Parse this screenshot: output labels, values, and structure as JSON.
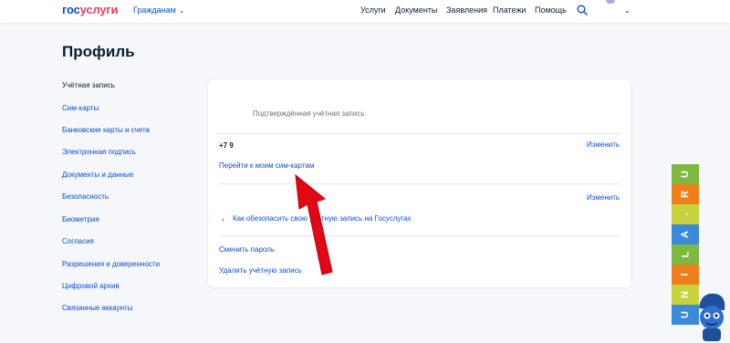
{
  "header": {
    "logo_part1": "гос",
    "logo_part2": "услуги",
    "citizens_label": "Гражданам",
    "nav": [
      "Услуги",
      "Документы",
      "Заявления",
      "Платежи",
      "Помощь"
    ]
  },
  "profile": {
    "title": "Профиль"
  },
  "sidebar": {
    "items": [
      {
        "label": "Учётная запись"
      },
      {
        "label": "Сим-карты"
      },
      {
        "label": "Банковские карты и счета"
      },
      {
        "label": "Электронная подпись"
      },
      {
        "label": "Документы и данные"
      },
      {
        "label": "Безопасность"
      },
      {
        "label": "Биометрия"
      },
      {
        "label": "Согласия"
      },
      {
        "label": "Разрешения и доверенности"
      },
      {
        "label": "Цифровой архив"
      },
      {
        "label": "Связанные аккаунты"
      }
    ]
  },
  "card": {
    "verified_text": "Подтверждённая учётная запись",
    "phone": "+7 9",
    "edit_label_1": "Изменить",
    "sim_link": "Перейти к моим сим-картам",
    "edit_label_2": "Изменить",
    "protect_link": "Как обезопасить свою учётную запись на Госуслугах",
    "change_password": "Сменить пароль",
    "delete_account": "Удалить учётную запись"
  },
  "watermark": {
    "letters": [
      "U",
      "N",
      "I",
      "L",
      "A",
      ".",
      "R",
      "U"
    ]
  },
  "colors": {
    "brand_blue": "#0d4cd3",
    "brand_red": "#ee3f58",
    "arrow_red": "#e30613"
  }
}
